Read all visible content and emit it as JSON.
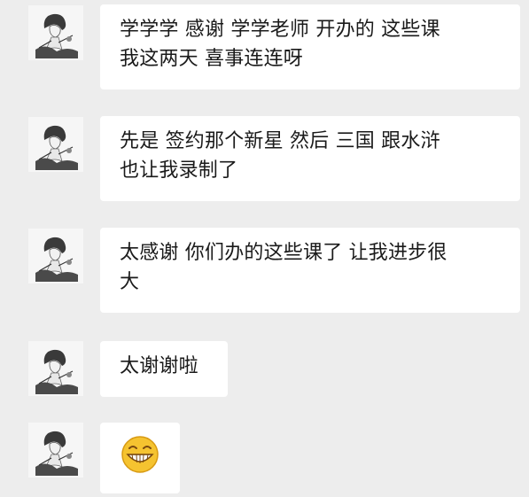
{
  "messages": [
    {
      "lines": [
        "学学学 感谢 学学老师 开办的 这些课",
        " 我这两天 喜事连连呀"
      ],
      "avatar_icon": "sketch-portrait-avatar-icon"
    },
    {
      "lines": [
        "先是 签约那个新星  然后 三国 跟水浒",
        "也让我录制了"
      ],
      "avatar_icon": "sketch-portrait-avatar-icon"
    },
    {
      "lines": [
        "太感谢 你们办的这些课了 让我进步很",
        "大"
      ],
      "avatar_icon": "sketch-portrait-avatar-icon"
    },
    {
      "lines": [
        "太谢谢啦"
      ],
      "avatar_icon": "sketch-portrait-avatar-icon"
    },
    {
      "emoji": "grin-emoji-icon",
      "avatar_icon": "sketch-portrait-avatar-icon"
    }
  ],
  "colors": {
    "background": "#ededed",
    "bubble": "#ffffff",
    "text": "#1a1a1a",
    "emoji_face": "#f5c330"
  }
}
